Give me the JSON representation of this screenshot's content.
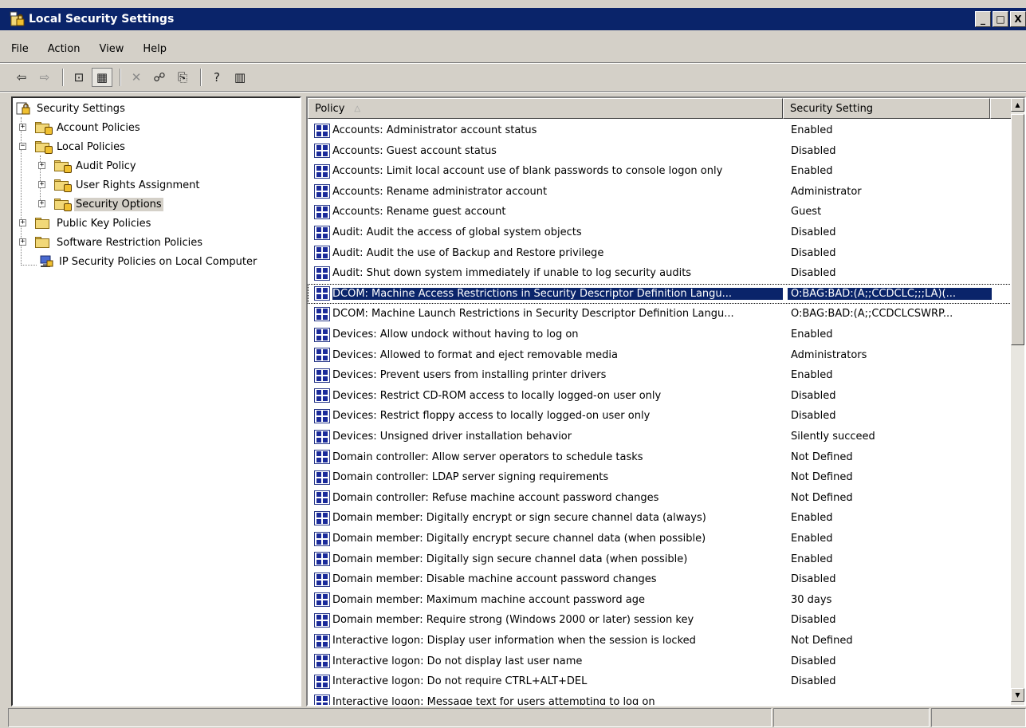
{
  "window": {
    "title": "Local Security Settings",
    "minimize_glyph": "_",
    "maximize_glyph": "□",
    "close_glyph": "X"
  },
  "menu": [
    "File",
    "Action",
    "View",
    "Help"
  ],
  "toolbar": {
    "back": "⇦",
    "forward": "⇨",
    "up": "⊡",
    "show_hide_tree": "▦",
    "delete": "✕",
    "properties": "☍",
    "export": "⎘",
    "help": "?",
    "action_pane": "▥"
  },
  "tree": {
    "root": "Security Settings",
    "items": [
      "Account Policies",
      "Local Policies",
      "Audit Policy",
      "User Rights Assignment",
      "Security Options",
      "Public Key Policies",
      "Software Restriction Policies",
      "IP Security Policies on Local Computer"
    ],
    "expander_plus": "+",
    "expander_minus": "−"
  },
  "list": {
    "columns": {
      "policy": "Policy",
      "setting": "Security Setting"
    },
    "sort_glyph": "△",
    "rows": [
      {
        "policy": "Accounts: Administrator account status",
        "setting": "Enabled"
      },
      {
        "policy": "Accounts: Guest account status",
        "setting": "Disabled"
      },
      {
        "policy": "Accounts: Limit local account use of blank passwords to console logon only",
        "setting": "Enabled"
      },
      {
        "policy": "Accounts: Rename administrator account",
        "setting": "Administrator"
      },
      {
        "policy": "Accounts: Rename guest account",
        "setting": "Guest"
      },
      {
        "policy": "Audit: Audit the access of global system objects",
        "setting": "Disabled"
      },
      {
        "policy": "Audit: Audit the use of Backup and Restore privilege",
        "setting": "Disabled"
      },
      {
        "policy": "Audit: Shut down system immediately if unable to log security audits",
        "setting": "Disabled"
      },
      {
        "policy": "DCOM: Machine Access Restrictions in Security Descriptor Definition Langu...",
        "setting": "O:BAG:BAD:(A;;CCDCLC;;;LA)(..."
      },
      {
        "policy": "DCOM: Machine Launch Restrictions in Security Descriptor Definition Langu...",
        "setting": "O:BAG:BAD:(A;;CCDCLCSWRP..."
      },
      {
        "policy": "Devices: Allow undock without having to log on",
        "setting": "Enabled"
      },
      {
        "policy": "Devices: Allowed to format and eject removable media",
        "setting": "Administrators"
      },
      {
        "policy": "Devices: Prevent users from installing printer drivers",
        "setting": "Enabled"
      },
      {
        "policy": "Devices: Restrict CD-ROM access to locally logged-on user only",
        "setting": "Disabled"
      },
      {
        "policy": "Devices: Restrict floppy access to locally logged-on user only",
        "setting": "Disabled"
      },
      {
        "policy": "Devices: Unsigned driver installation behavior",
        "setting": "Silently succeed"
      },
      {
        "policy": "Domain controller: Allow server operators to schedule tasks",
        "setting": "Not Defined"
      },
      {
        "policy": "Domain controller: LDAP server signing requirements",
        "setting": "Not Defined"
      },
      {
        "policy": "Domain controller: Refuse machine account password changes",
        "setting": "Not Defined"
      },
      {
        "policy": "Domain member: Digitally encrypt or sign secure channel data (always)",
        "setting": "Enabled"
      },
      {
        "policy": "Domain member: Digitally encrypt secure channel data (when possible)",
        "setting": "Enabled"
      },
      {
        "policy": "Domain member: Digitally sign secure channel data (when possible)",
        "setting": "Enabled"
      },
      {
        "policy": "Domain member: Disable machine account password changes",
        "setting": "Disabled"
      },
      {
        "policy": "Domain member: Maximum machine account password age",
        "setting": "30 days"
      },
      {
        "policy": "Domain member: Require strong (Windows 2000 or later) session key",
        "setting": "Disabled"
      },
      {
        "policy": "Interactive logon: Display user information when the session is locked",
        "setting": "Not Defined"
      },
      {
        "policy": "Interactive logon: Do not display last user name",
        "setting": "Disabled"
      },
      {
        "policy": "Interactive logon: Do not require CTRL+ALT+DEL",
        "setting": "Disabled"
      },
      {
        "policy": "Interactive logon: Message text for users attempting to log on",
        "setting": ""
      }
    ]
  },
  "scrollbar": {
    "up": "▲",
    "down": "▼"
  }
}
